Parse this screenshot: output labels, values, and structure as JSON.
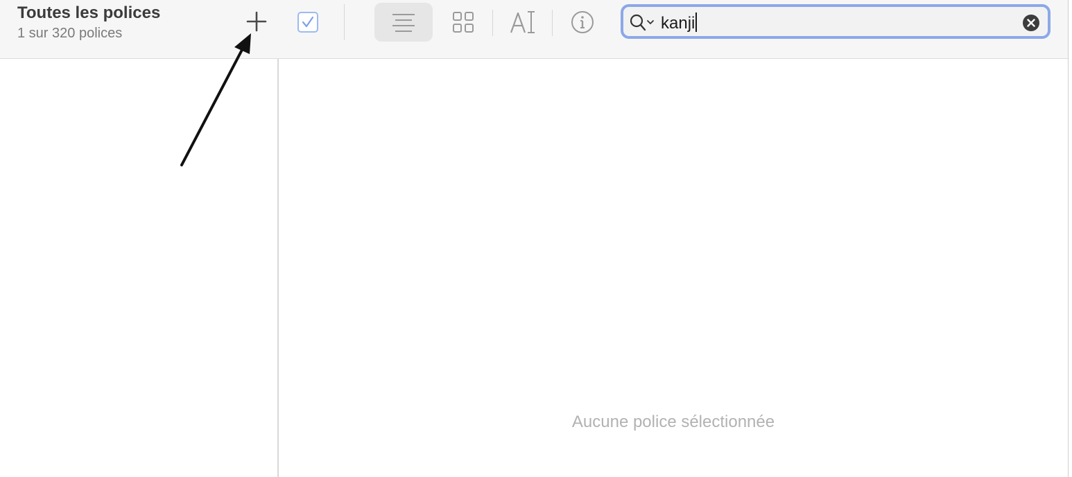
{
  "header": {
    "title": "Toutes les polices",
    "subtitle": "1 sur 320 polices"
  },
  "toolbar": {
    "buttons": [
      {
        "name": "add-collection",
        "icon": "plus-icon"
      },
      {
        "name": "enable-font",
        "icon": "checkbox-icon"
      },
      {
        "name": "view-list",
        "icon": "list-view-icon",
        "selected": true
      },
      {
        "name": "view-grid",
        "icon": "grid-view-icon"
      },
      {
        "name": "sample-text",
        "icon": "text-cursor-icon"
      },
      {
        "name": "font-info",
        "icon": "info-icon"
      }
    ]
  },
  "search": {
    "value": "kanji",
    "icon": "search-icon",
    "clear_icon": "clear-icon"
  },
  "main": {
    "empty_message": "Aucune police sélectionnée"
  },
  "colors": {
    "search_focus_ring": "#8ca8e8",
    "checkbox_accent": "#7ea2e6",
    "toolbar_bg": "#f6f6f6"
  }
}
